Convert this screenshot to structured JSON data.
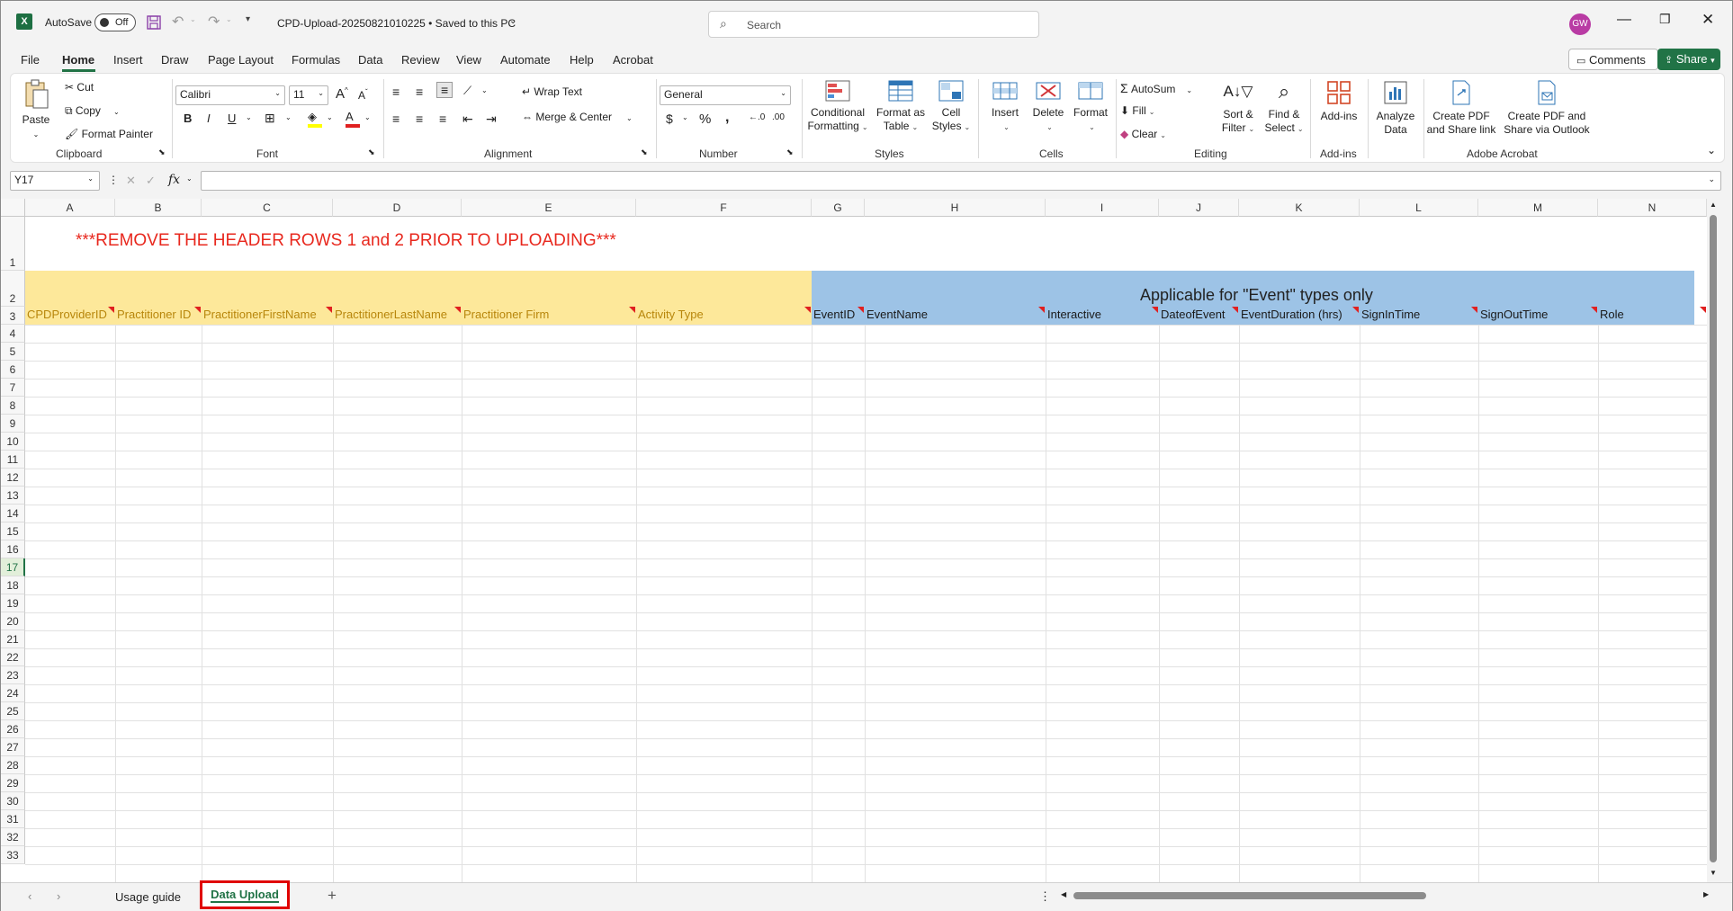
{
  "title_bar": {
    "autosave_label": "AutoSave",
    "autosave_state": "Off",
    "doc_title": "CPD-Upload-20250821010225 • Saved to this PC",
    "search_placeholder": "Search",
    "avatar_initials": "GW"
  },
  "menu": [
    "File",
    "Home",
    "Insert",
    "Draw",
    "Page Layout",
    "Formulas",
    "Data",
    "Review",
    "View",
    "Automate",
    "Help",
    "Acrobat"
  ],
  "menu_active": "Home",
  "comments_label": "Comments",
  "share_label": "Share",
  "ribbon": {
    "clipboard": {
      "label": "Clipboard",
      "paste": "Paste",
      "cut": "Cut",
      "copy": "Copy",
      "format_painter": "Format Painter"
    },
    "font": {
      "label": "Font",
      "name": "Calibri",
      "size": "11"
    },
    "alignment": {
      "label": "Alignment",
      "wrap_text": "Wrap Text",
      "merge_center": "Merge & Center"
    },
    "number": {
      "label": "Number",
      "format": "General"
    },
    "styles": {
      "label": "Styles",
      "conditional_1": "Conditional",
      "conditional_2": "Formatting",
      "format_table_1": "Format as",
      "format_table_2": "Table",
      "cell_styles_1": "Cell",
      "cell_styles_2": "Styles"
    },
    "cells": {
      "label": "Cells",
      "insert": "Insert",
      "delete": "Delete",
      "format": "Format"
    },
    "editing": {
      "label": "Editing",
      "autosum": "AutoSum",
      "fill": "Fill",
      "clear": "Clear",
      "sort_1": "Sort &",
      "sort_2": "Filter",
      "find_1": "Find &",
      "find_2": "Select"
    },
    "addins": {
      "label": "Add-ins",
      "addins": "Add-ins"
    },
    "analyze": {
      "analyze_1": "Analyze",
      "analyze_2": "Data"
    },
    "acrobat": {
      "label": "Adobe Acrobat",
      "pdf_share_1": "Create PDF",
      "pdf_share_2": "and Share link",
      "pdf_outlook_1": "Create PDF and",
      "pdf_outlook_2": "Share via Outlook"
    }
  },
  "formula_bar": {
    "name_box": "Y17",
    "fx": "fx",
    "content": ""
  },
  "columns": [
    "A",
    "B",
    "C",
    "D",
    "E",
    "F",
    "G",
    "H",
    "I",
    "J",
    "K",
    "L",
    "M",
    "N"
  ],
  "rows": [
    "1",
    "2",
    "3",
    "4",
    "5",
    "6",
    "7",
    "8",
    "9",
    "10",
    "11",
    "12",
    "13",
    "14",
    "15",
    "16",
    "17",
    "18",
    "19",
    "20",
    "21",
    "22",
    "23",
    "24",
    "25",
    "26",
    "27",
    "28",
    "29",
    "30",
    "31",
    "32",
    "33"
  ],
  "sheet": {
    "warning": "***REMOVE THE HEADER ROWS 1 and 2 PRIOR TO UPLOADING***",
    "event_banner": "Applicable for \"Event\" types only",
    "headers": [
      "CPDProviderID",
      "Practitioner ID",
      "PractitionerFirstName",
      "PractitionerLastName",
      "Practitioner Firm",
      "Activity Type",
      "EventID",
      "EventName",
      "Interactive",
      "DateofEvent",
      "EventDuration (hrs)",
      "SignInTime",
      "SignOutTime",
      "Role"
    ]
  },
  "tabs": {
    "items": [
      "Usage guide",
      "Data Upload"
    ],
    "active": "Data Upload"
  },
  "colors": {
    "yellow_fill": "#fde89a",
    "blue_fill": "#9dc3e6",
    "warning_red": "#e8281e",
    "header_gold": "#b8860b",
    "accent_green": "#217346"
  }
}
